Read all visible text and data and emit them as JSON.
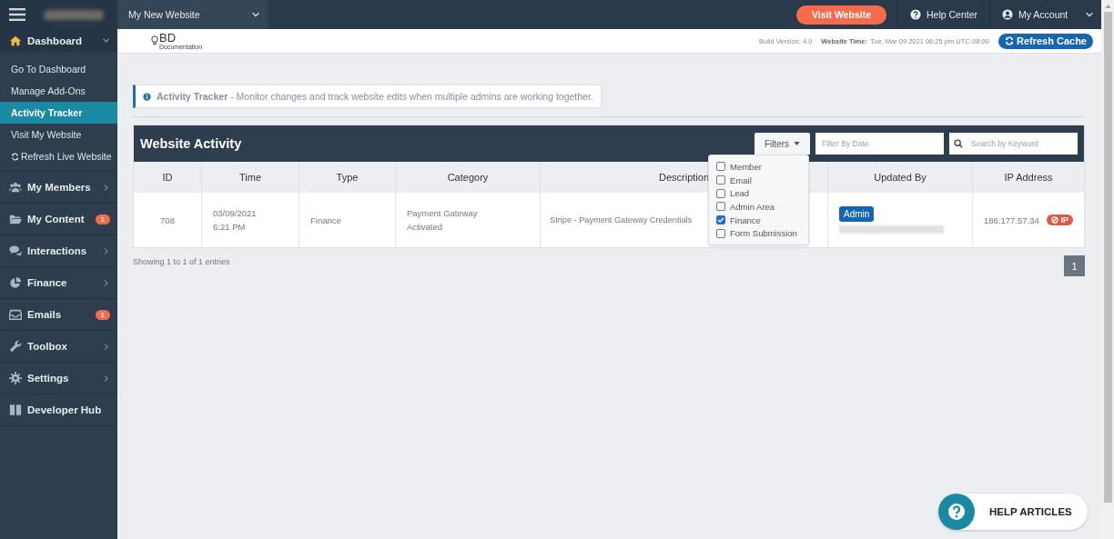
{
  "topbar": {
    "site_selector": "My New Website",
    "visit_button": "Visit Website",
    "help_link": "Help Center",
    "account_menu": "My Account"
  },
  "subheader": {
    "logo_text": "BD",
    "logo_caption": "Documentation",
    "build_version": "Build Version: 4.0",
    "time_label": "Website Time:",
    "time_value": "Tue, Mar 09 2021 06:25 pm UTC-08:00",
    "refresh_button": "Refresh Cache"
  },
  "sidebar": {
    "items": [
      {
        "label": "Dashboard",
        "expanded": true,
        "children": [
          {
            "label": "Go To Dashboard",
            "selected": false
          },
          {
            "label": "Manage Add-Ons",
            "selected": false
          },
          {
            "label": "Activity Tracker",
            "selected": true
          },
          {
            "label": "Visit My Website",
            "selected": false
          },
          {
            "label": "Refresh Live Website",
            "selected": false
          }
        ]
      },
      {
        "label": "My Members",
        "expanded": false
      },
      {
        "label": "My Content",
        "badge": "1"
      },
      {
        "label": "Interactions",
        "expanded": false
      },
      {
        "label": "Finance",
        "expanded": false
      },
      {
        "label": "Emails",
        "badge": "1"
      },
      {
        "label": "Toolbox",
        "expanded": false
      },
      {
        "label": "Settings",
        "expanded": false
      },
      {
        "label": "Developer Hub"
      }
    ]
  },
  "notice": "**Activity Tracker** - Monitor changes and track website edits when multiple admins are working together.",
  "panel": {
    "title": "Website Activity",
    "filters_button": "Filters",
    "filter_options": [
      {
        "label": "Member",
        "checked": false
      },
      {
        "label": "Email",
        "checked": false
      },
      {
        "label": "Lead",
        "checked": false
      },
      {
        "label": "Admin Area",
        "checked": false
      },
      {
        "label": "Finance",
        "checked": true
      },
      {
        "label": "Form Submission",
        "checked": false
      }
    ],
    "date_filter": {
      "placeholder": "Filter By Date"
    },
    "keyword_search": {
      "placeholder": "Search by Keyword"
    },
    "table": {
      "columns": [
        "ID",
        "Time",
        "Type",
        "Category",
        "Description",
        "Updated By",
        "IP Address"
      ],
      "rows": [
        {
          "id": "708",
          "time": [
            "03/09/2021",
            "6:21 PM"
          ],
          "type": "Finance",
          "category": [
            "Payment Gateway",
            "Activated"
          ],
          "description": "Stripe - Payment Gateway Credentials",
          "updated_by": "Admin",
          "ip_address": "186.177.57.34",
          "ip_badge": "IP"
        }
      ]
    }
  },
  "footer": {
    "entries": "Showing 1 to 1 of 1 entries",
    "pages": [
      {
        "label": "1",
        "selected": true
      }
    ]
  },
  "help_button": "HELP ARTICLES"
}
